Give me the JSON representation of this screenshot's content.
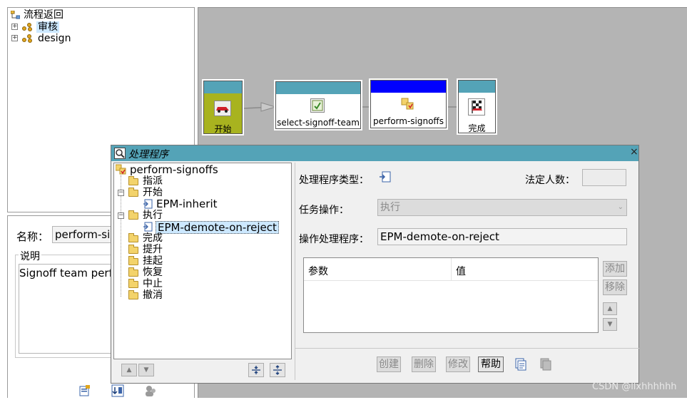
{
  "left_tree": {
    "root": "流程返回",
    "items": [
      {
        "label": "审核",
        "selected": true
      },
      {
        "label": "design",
        "selected": false
      }
    ]
  },
  "left_panel": {
    "name_label": "名称：",
    "name_value": "perform-signoffs",
    "description_label": "说明",
    "description_text": "Signoff team performs the signoffs"
  },
  "workflow": {
    "nodes": [
      {
        "label": "开始"
      },
      {
        "label": "select-signoff-team"
      },
      {
        "label": "perform-signoffs"
      },
      {
        "label": "完成"
      }
    ]
  },
  "dialog": {
    "title": "处理程序",
    "close_glyph": "×",
    "tree": {
      "root": "perform-signoffs",
      "items": [
        {
          "label": "指派"
        },
        {
          "label": "开始"
        },
        {
          "label": "EPM-inherit"
        },
        {
          "label": "执行"
        },
        {
          "label": "EPM-demote-on-reject"
        },
        {
          "label": "完成"
        },
        {
          "label": "提升"
        },
        {
          "label": "挂起"
        },
        {
          "label": "恢复"
        },
        {
          "label": "中止"
        },
        {
          "label": "撤消"
        }
      ]
    },
    "form": {
      "handler_type_label": "处理程序类型：",
      "quorum_label": "法定人数：",
      "quorum_value": "",
      "task_action_label": "任务操作：",
      "task_action_value": "执行",
      "handler_label": "操作处理程序：",
      "handler_value": "EPM-demote-on-reject",
      "table": {
        "columns": [
          "参数",
          "值"
        ],
        "rows": []
      }
    },
    "side_buttons": {
      "add": "添加",
      "remove": "移除"
    },
    "bottom_buttons": {
      "create": "创建",
      "delete": "删除",
      "modify": "修改",
      "help": "帮助"
    }
  },
  "watermark": "CSDN @llxhhhhhh",
  "colors": {
    "canvas": "#b4b4b4",
    "title_bar": "#54a3b7",
    "start_node": "#a8b31f",
    "selected_node_header": "#0000ff",
    "node_header": "#54a3b7",
    "tree_selection": "#cce8ff"
  }
}
